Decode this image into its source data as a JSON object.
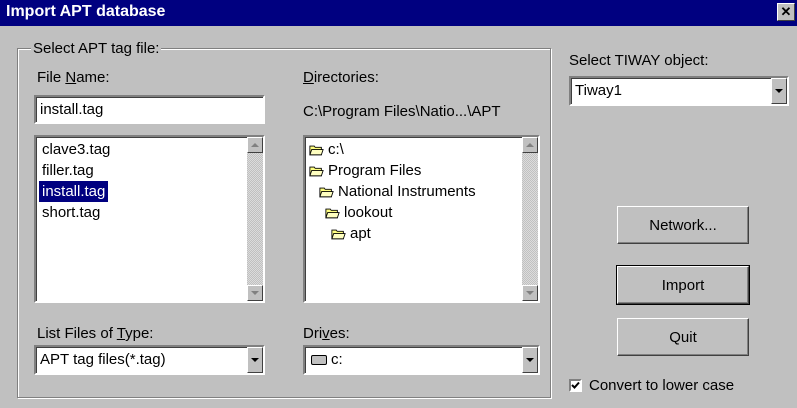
{
  "window": {
    "title": "Import APT database",
    "close_glyph": "✕"
  },
  "group": {
    "legend": "Select APT tag file:"
  },
  "file_name": {
    "label_pre": "File ",
    "label_ul": "N",
    "label_post": "ame:",
    "value": "install.tag",
    "items": [
      "clave3.tag",
      "filler.tag",
      "install.tag",
      "short.tag"
    ],
    "selected_index": 2
  },
  "directories": {
    "label_pre": "",
    "label_ul": "D",
    "label_post": "irectories:",
    "path": "C:\\Program Files\\Natio...\\APT",
    "items": [
      {
        "label": "c:\\",
        "icon": "open-folder-icon"
      },
      {
        "label": "Program Files",
        "icon": "open-folder-icon"
      },
      {
        "label": "National Instruments",
        "icon": "open-folder-icon"
      },
      {
        "label": "lookout",
        "icon": "open-folder-icon"
      },
      {
        "label": "apt",
        "icon": "open-folder-icon"
      }
    ]
  },
  "file_type": {
    "label_pre": "List Files of ",
    "label_ul": "T",
    "label_post": "ype:",
    "value": "APT tag files(*.tag)"
  },
  "drives": {
    "label_pre": "Dri",
    "label_ul": "v",
    "label_post": "es:",
    "value": "c:",
    "icon": "drive-icon"
  },
  "tiway": {
    "label": "Select TIWAY object:",
    "value": "Tiway1"
  },
  "buttons": {
    "network": "Network...",
    "import": "Import",
    "quit": "Quit"
  },
  "convert": {
    "label": "Convert to lower case",
    "checked": true
  }
}
